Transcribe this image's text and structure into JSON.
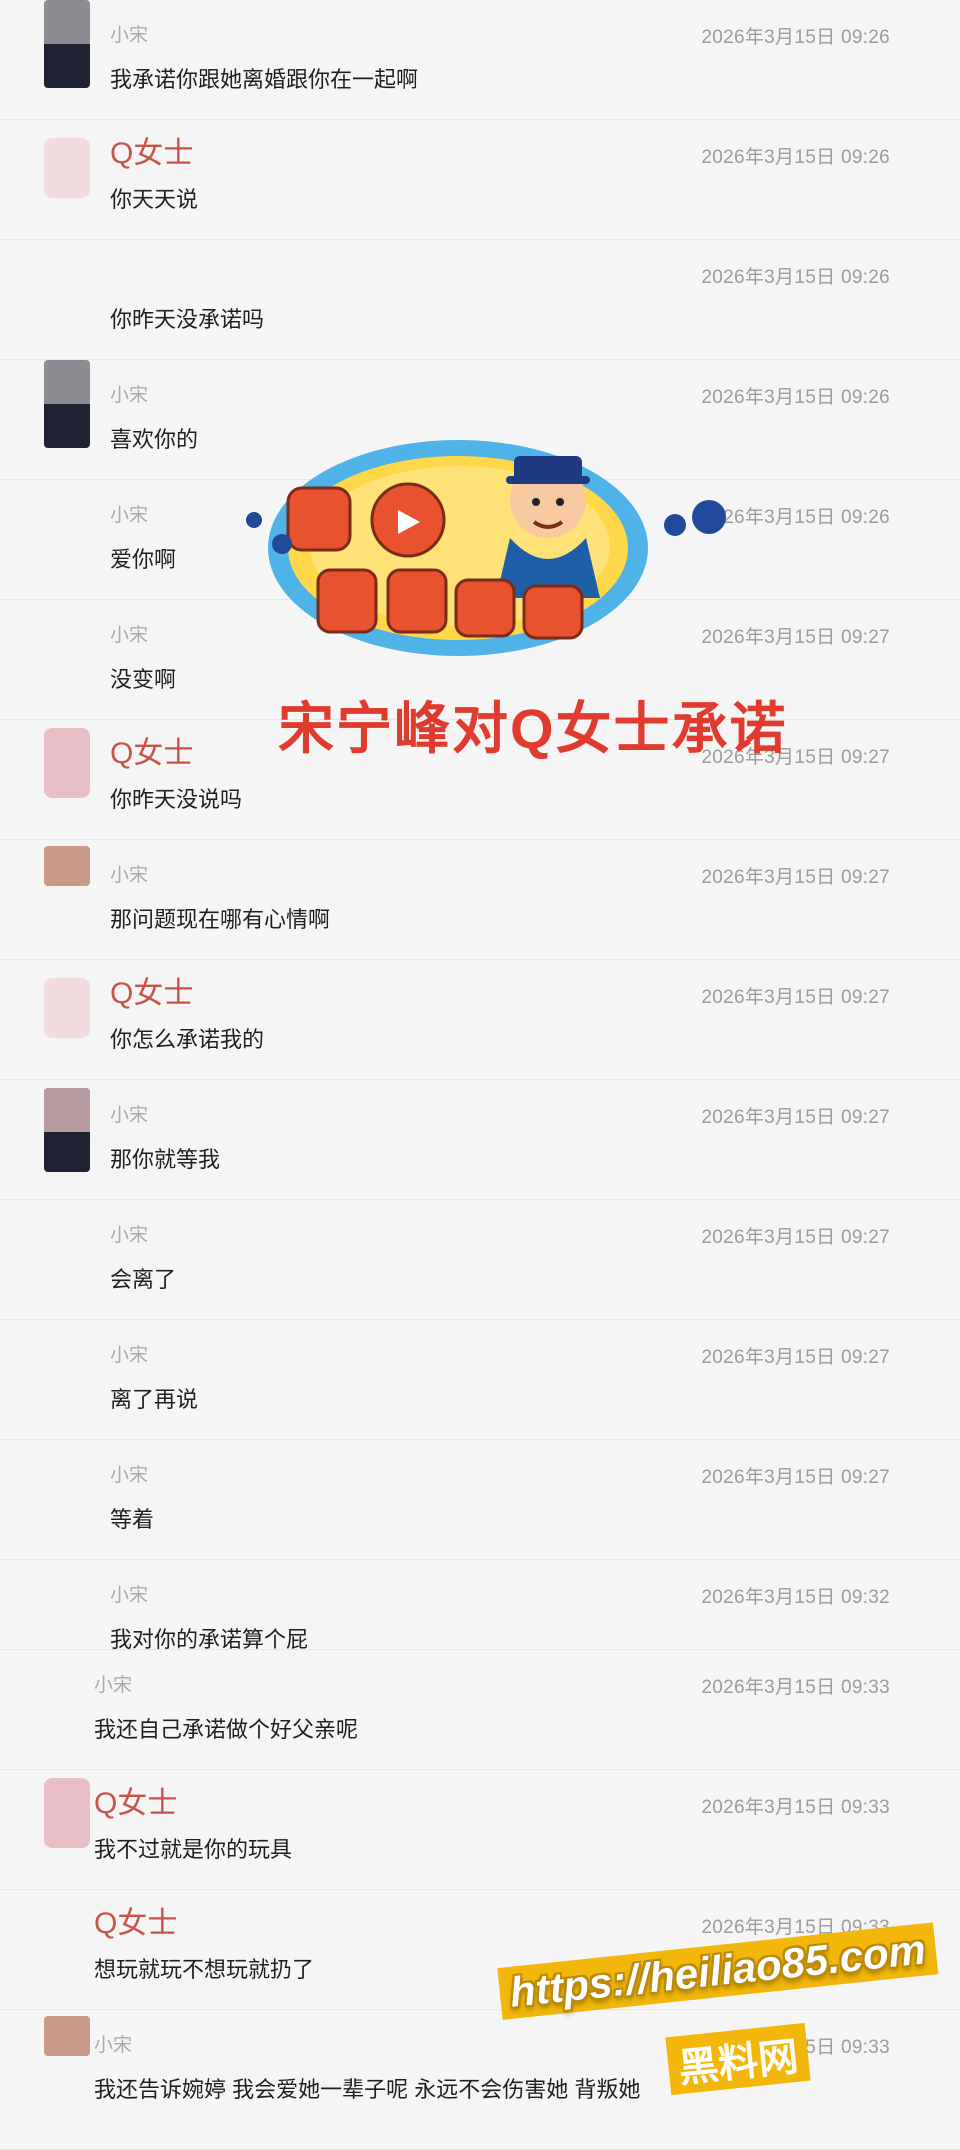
{
  "messages": [
    {
      "sender": "小宋",
      "time": "2026年3月15日 09:26",
      "text": "我承诺你跟她离婚跟你在一起啊",
      "avatar": "dark"
    },
    {
      "sender": "Q女士",
      "time": "2026年3月15日 09:26",
      "text": "你天天说",
      "avatar": "pink"
    },
    {
      "sender": "",
      "time": "2026年3月15日 09:26",
      "text": "你昨天没承诺吗",
      "avatar": "none"
    },
    {
      "sender": "小宋",
      "time": "2026年3月15日 09:26",
      "text": "喜欢你的",
      "avatar": "dark"
    },
    {
      "sender": "小宋",
      "time": "2026年3月15日 09:26",
      "text": "爱你啊",
      "avatar": "none"
    },
    {
      "sender": "小宋",
      "time": "2026年3月15日 09:27",
      "text": "没变啊",
      "avatar": "none"
    },
    {
      "sender": "Q女士",
      "time": "2026年3月15日 09:27",
      "text": "你昨天没说吗",
      "avatar": "pink2"
    },
    {
      "sender": "小宋",
      "time": "2026年3月15日 09:27",
      "text": "那问题现在哪有心情啊",
      "avatar": "tan"
    },
    {
      "sender": "Q女士",
      "time": "2026年3月15日 09:27",
      "text": "你怎么承诺我的",
      "avatar": "pink"
    },
    {
      "sender": "小宋",
      "time": "2026年3月15日 09:27",
      "text": "那你就等我",
      "avatar": "mauve"
    },
    {
      "sender": "小宋",
      "time": "2026年3月15日 09:27",
      "text": "会离了",
      "avatar": "none"
    },
    {
      "sender": "小宋",
      "time": "2026年3月15日 09:27",
      "text": "离了再说",
      "avatar": "none"
    },
    {
      "sender": "小宋",
      "time": "2026年3月15日 09:27",
      "text": "等着",
      "avatar": "none"
    },
    {
      "sender": "小宋",
      "time": "2026年3月15日 09:32",
      "text": "我对你的承诺算个屁",
      "avatar": "none"
    },
    {
      "sender": "小宋",
      "time": "2026年3月15日 09:33",
      "text": "我还自己承诺做个好父亲呢",
      "avatar": "none"
    },
    {
      "sender": "Q女士",
      "time": "2026年3月15日 09:33",
      "text": "我不过就是你的玩具",
      "avatar": "pink2"
    },
    {
      "sender": "Q女士",
      "time": "2026年3月15日 09:33",
      "text": "想玩就玩不想玩就扔了",
      "avatar": "none"
    },
    {
      "sender": "小宋",
      "time": "2026年3月15日 09:33",
      "text": "我还告诉婉婷 我会爱她一辈子呢 永远不会伤害她 背叛她",
      "avatar": "tan"
    }
  ],
  "overlay": {
    "caption": "宋宁峰对Q女士承诺"
  },
  "watermark": {
    "url": "https://heiliao85.com",
    "site": "黑料网"
  },
  "colors": {
    "background": "#f5f5f5",
    "lady_name": "#c9534a",
    "caption": "#e03b2f",
    "watermark_bg": "#f2b70a"
  }
}
